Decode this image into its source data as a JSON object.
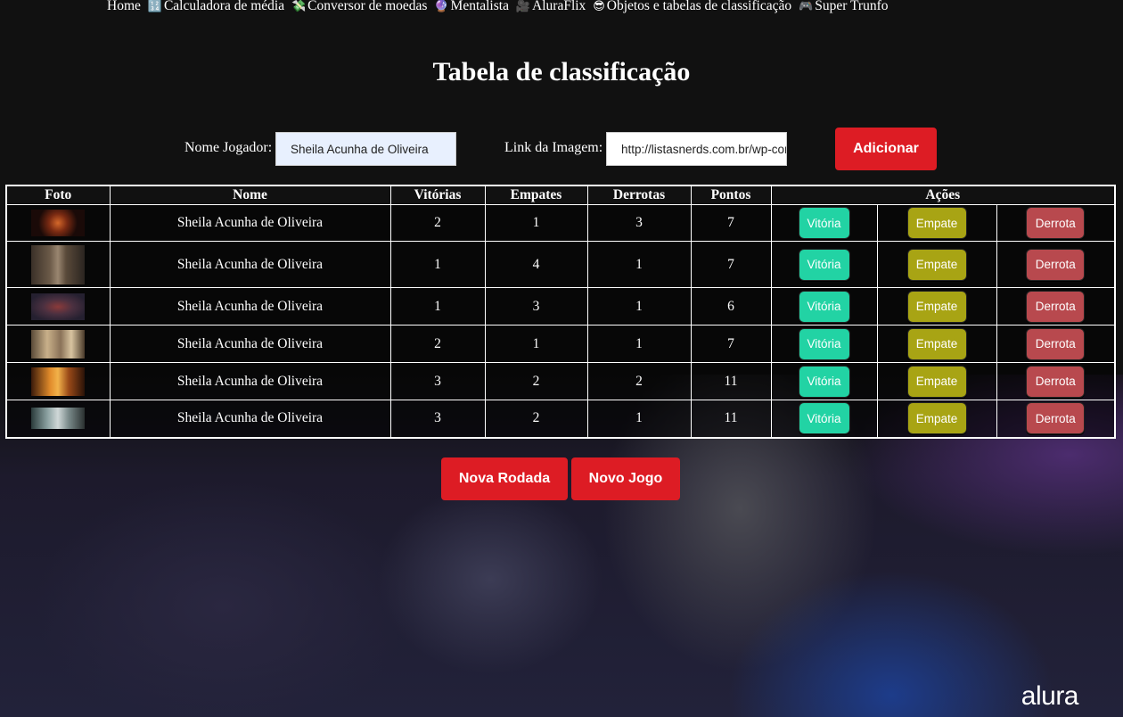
{
  "nav": {
    "items": [
      {
        "icon": "",
        "label": "Home"
      },
      {
        "icon": "🔢",
        "label": "Calculadora de média"
      },
      {
        "icon": "💸",
        "label": "Conversor de moedas"
      },
      {
        "icon": "🔮",
        "label": "Mentalista"
      },
      {
        "icon": "🎥",
        "label": "AluraFlix"
      },
      {
        "icon": "😎",
        "label": "Objetos e tabelas de classificação"
      },
      {
        "icon": "🎮",
        "label": "Super Trunfo"
      }
    ]
  },
  "page_title": "Tabela de classificação",
  "form": {
    "name_label": "Nome Jogador:",
    "name_value": "Sheila Acunha de Oliveira",
    "image_label": "Link da Imagem:",
    "image_value": "http://listasnerds.com.br/wp-content/uploads/",
    "add_button": "Adicionar"
  },
  "table": {
    "headers": [
      "Foto",
      "Nome",
      "Vitórias",
      "Empates",
      "Derrotas",
      "Pontos",
      "Ações"
    ],
    "rows": [
      {
        "name": "Sheila Acunha de Oliveira",
        "wins": "2",
        "draws": "1",
        "losses": "3",
        "points": "7"
      },
      {
        "name": "Sheila Acunha de Oliveira",
        "wins": "1",
        "draws": "4",
        "losses": "1",
        "points": "7"
      },
      {
        "name": "Sheila Acunha de Oliveira",
        "wins": "1",
        "draws": "3",
        "losses": "1",
        "points": "6"
      },
      {
        "name": "Sheila Acunha de Oliveira",
        "wins": "2",
        "draws": "1",
        "losses": "1",
        "points": "7"
      },
      {
        "name": "Sheila Acunha de Oliveira",
        "wins": "3",
        "draws": "2",
        "losses": "2",
        "points": "11"
      },
      {
        "name": "Sheila Acunha de Oliveira",
        "wins": "3",
        "draws": "2",
        "losses": "1",
        "points": "11"
      }
    ],
    "action_labels": {
      "win": "Vitória",
      "draw": "Empate",
      "loss": "Derrota"
    }
  },
  "footer_buttons": {
    "new_round": "Nova Rodada",
    "new_game": "Novo Jogo"
  },
  "brand_logo": "alura",
  "colors": {
    "accent_red": "#dd1c24",
    "win": "#22d3a4",
    "draw": "#a8a414",
    "loss": "#b8494e"
  }
}
